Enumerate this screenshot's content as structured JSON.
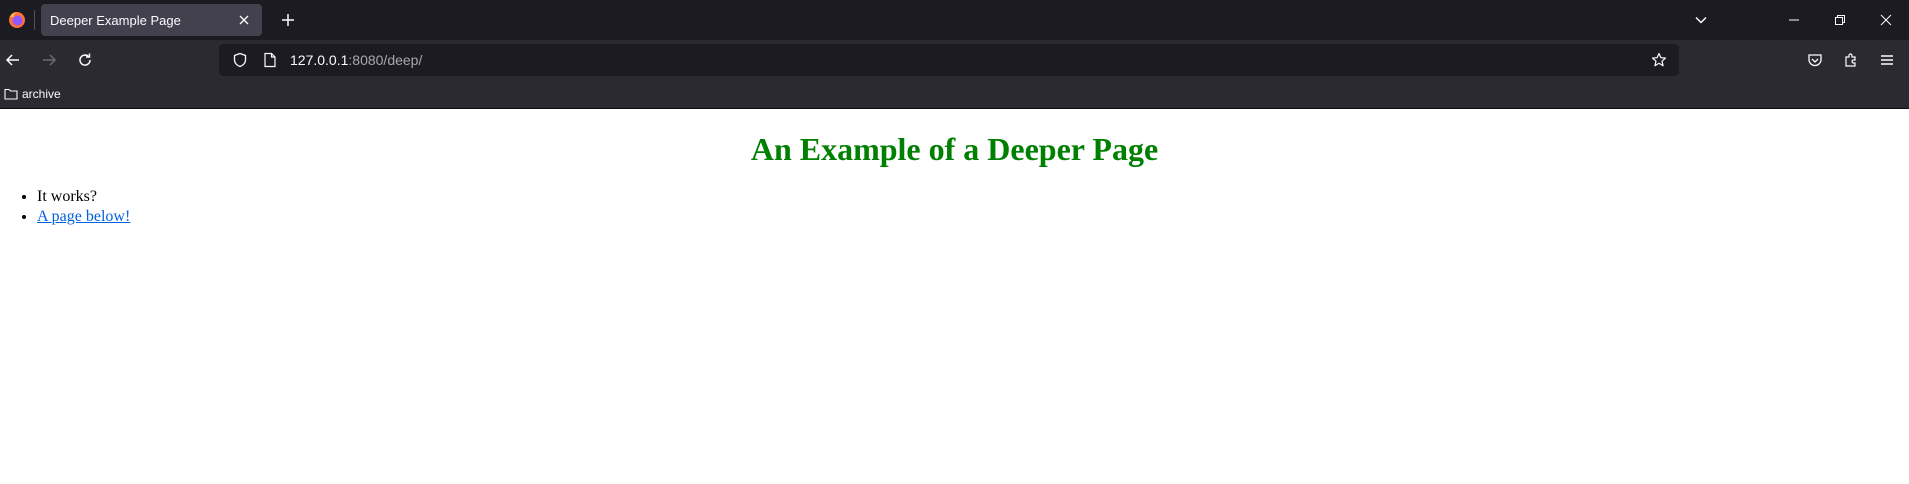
{
  "browser": {
    "tab": {
      "title": "Deeper Example Page"
    },
    "address": {
      "host": "127.0.0.1",
      "rest": ":8080/deep/"
    },
    "bookmarks": [
      {
        "label": "archive"
      }
    ],
    "colors": {
      "chrome_dark": "#1c1b22",
      "toolbar": "#2b2a33",
      "tab_active": "#42414d"
    }
  },
  "page": {
    "heading": "An Example of a Deeper Page",
    "items": [
      {
        "text": "It works?"
      },
      {
        "text": "A page below!"
      }
    ],
    "colors": {
      "heading": "#008000",
      "link": "#0060df"
    }
  }
}
